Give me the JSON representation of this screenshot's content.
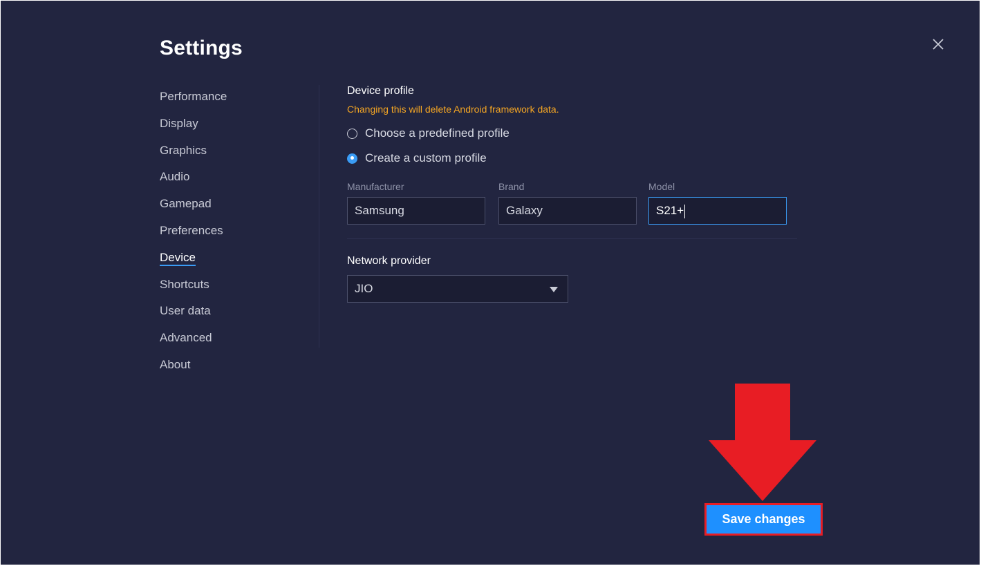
{
  "page": {
    "title": "Settings"
  },
  "nav": {
    "items": [
      {
        "label": "Performance",
        "active": false
      },
      {
        "label": "Display",
        "active": false
      },
      {
        "label": "Graphics",
        "active": false
      },
      {
        "label": "Audio",
        "active": false
      },
      {
        "label": "Gamepad",
        "active": false
      },
      {
        "label": "Preferences",
        "active": false
      },
      {
        "label": "Device",
        "active": true
      },
      {
        "label": "Shortcuts",
        "active": false
      },
      {
        "label": "User data",
        "active": false
      },
      {
        "label": "Advanced",
        "active": false
      },
      {
        "label": "About",
        "active": false
      }
    ]
  },
  "device_profile": {
    "title": "Device profile",
    "warning": "Changing this will delete Android framework data.",
    "options": [
      {
        "label": "Choose a predefined profile",
        "selected": false
      },
      {
        "label": "Create a custom profile",
        "selected": true
      }
    ],
    "fields": {
      "manufacturer": {
        "label": "Manufacturer",
        "value": "Samsung"
      },
      "brand": {
        "label": "Brand",
        "value": "Galaxy"
      },
      "model": {
        "label": "Model",
        "value": "S21+"
      }
    }
  },
  "network": {
    "label": "Network provider",
    "selected": "JIO"
  },
  "footer": {
    "save_label": "Save changes"
  },
  "colors": {
    "background": "#222540",
    "accent": "#1e90ff",
    "warning": "#f5a623",
    "annotation": "#e81d24"
  },
  "icons": {
    "close": "close-icon",
    "dropdown": "chevron-down-icon",
    "annotation": "down-arrow-icon"
  }
}
